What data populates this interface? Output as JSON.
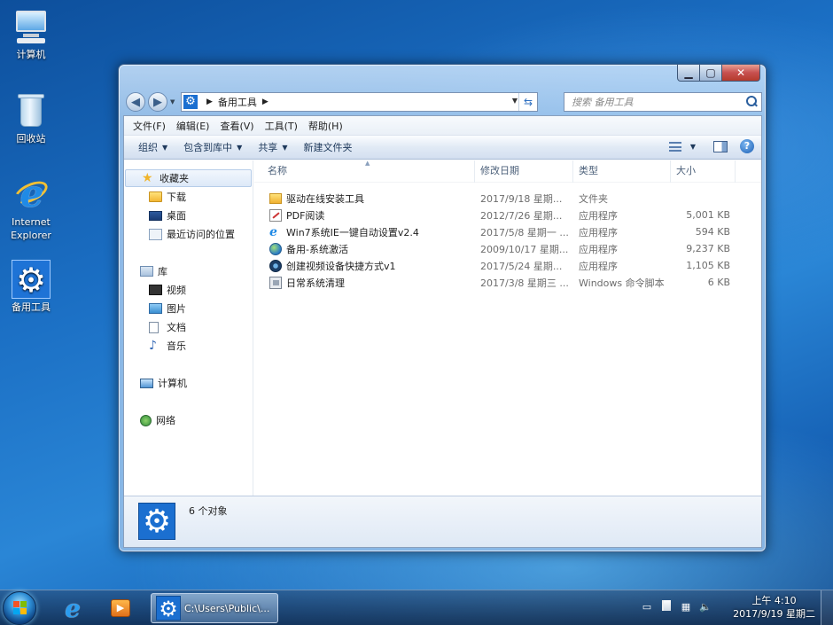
{
  "desktop": {
    "icons": [
      {
        "label": "计算机",
        "icon": "computer-icon"
      },
      {
        "label": "回收站",
        "icon": "recycle-bin-icon"
      },
      {
        "label": "Internet Explorer",
        "icon": "internet-explorer-icon"
      },
      {
        "label": "备用工具",
        "icon": "gear-icon"
      }
    ]
  },
  "window": {
    "address": {
      "current": "备用工具"
    },
    "search": {
      "placeholder": "搜索 备用工具"
    },
    "menu": [
      "文件(F)",
      "编辑(E)",
      "查看(V)",
      "工具(T)",
      "帮助(H)"
    ],
    "toolbar": {
      "organize": "组织",
      "include_library": "包含到库中",
      "share": "共享",
      "new_folder": "新建文件夹"
    },
    "nav": {
      "favorites": "收藏夹",
      "favorites_items": [
        "下载",
        "桌面",
        "最近访问的位置"
      ],
      "libraries": "库",
      "library_items": [
        "视频",
        "图片",
        "文档",
        "音乐"
      ],
      "computer": "计算机",
      "network": "网络"
    },
    "columns": {
      "name": "名称",
      "date": "修改日期",
      "type": "类型",
      "size": "大小"
    },
    "files": [
      {
        "name": "驱动在线安装工具",
        "date": "2017/9/18 星期...",
        "type": "文件夹",
        "size": "",
        "icon": "folder-icon"
      },
      {
        "name": "PDF阅读",
        "date": "2012/7/26 星期...",
        "type": "应用程序",
        "size": "5,001 KB",
        "icon": "pdf-app-icon"
      },
      {
        "name": "Win7系统IE一键自动设置v2.4",
        "date": "2017/5/8 星期一 ...",
        "type": "应用程序",
        "size": "594 KB",
        "icon": "ie-app-icon"
      },
      {
        "name": "备用-系统激活",
        "date": "2009/10/17 星期...",
        "type": "应用程序",
        "size": "9,237 KB",
        "icon": "globe-app-icon"
      },
      {
        "name": "创建视频设备快捷方式v1",
        "date": "2017/5/24 星期...",
        "type": "应用程序",
        "size": "1,105 KB",
        "icon": "camera-app-icon"
      },
      {
        "name": "日常系统清理",
        "date": "2017/3/8 星期三 ...",
        "type": "Windows 命令脚本",
        "size": "6 KB",
        "icon": "batch-script-icon"
      }
    ],
    "details": {
      "count": "6 个对象"
    }
  },
  "taskbar": {
    "active_window": "C:\\Users\\Public\\...",
    "clock_time": "上午 4:10",
    "clock_date": "2017/9/19 星期二"
  },
  "colors": {
    "accent": "#1b6fd0",
    "selection": "#dde9f8",
    "close_button": "#c75050"
  }
}
